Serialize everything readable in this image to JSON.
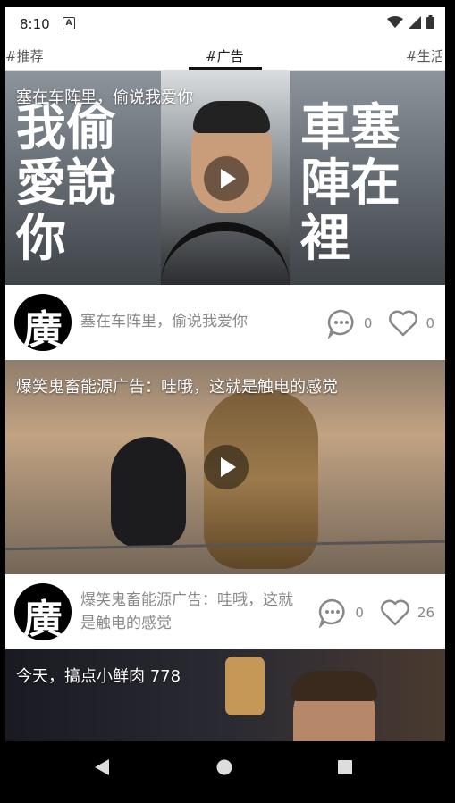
{
  "status": {
    "time": "8:10",
    "notif_icon": "A"
  },
  "tabs": [
    {
      "label": "#推荐"
    },
    {
      "label": "#广告"
    },
    {
      "label": "#生活"
    }
  ],
  "cards": [
    {
      "thumb_title": "塞在车阵里，偷说我爱你",
      "overlay_left": "我偷\n愛說\n你",
      "overlay_right": "車塞\n陣在\n裡",
      "avatar_char": "廣",
      "title": "塞在车阵里，偷说我爱你",
      "comments": "0",
      "likes": "0"
    },
    {
      "thumb_title": "爆笑鬼畜能源广告：哇哦，这就是触电的感觉",
      "avatar_char": "廣",
      "title": "爆笑鬼畜能源广告：哇哦，这就是触电的感觉",
      "comments": "0",
      "likes": "26"
    },
    {
      "thumb_title": "今天，搞点小鲜肉 778"
    }
  ],
  "colors": {
    "accent": "#111111",
    "meta_text": "#888888"
  }
}
